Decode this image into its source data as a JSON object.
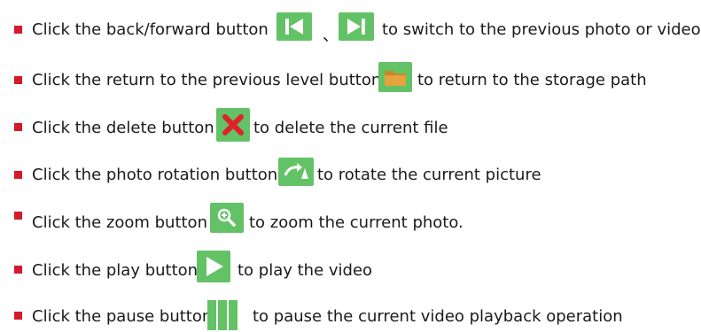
{
  "instructions": [
    {
      "pre": "Click the back/forward button",
      "separator": "、",
      "post": "to switch to the previous photo or video",
      "icons": [
        "skip-back-icon",
        "skip-forward-icon"
      ]
    },
    {
      "pre": "Click the return to the previous level button",
      "post": "to return to the storage path",
      "icons": [
        "folder-icon"
      ]
    },
    {
      "pre": "Click the delete button",
      "post": "to delete the current file",
      "icons": [
        "delete-x-icon"
      ]
    },
    {
      "pre": "Click the photo rotation button",
      "post": "to rotate the current picture",
      "icons": [
        "rotate-icon"
      ]
    },
    {
      "pre": "Click the zoom button",
      "post": "to zoom the current photo.",
      "icons": [
        "zoom-icon"
      ]
    },
    {
      "pre": "Click the play button",
      "post": "to play the video",
      "icons": [
        "play-icon"
      ]
    },
    {
      "pre": "Click the pause button",
      "post": "to pause the current video playback operation",
      "icons": [
        "pause-icon"
      ]
    }
  ],
  "colors": {
    "bullet": "#d4192a",
    "icon_bg": "#63c266",
    "icon_glyph": "#ffffff",
    "folder": "#e6a23c",
    "delete_x": "#e0202a",
    "text": "#1a1a1a"
  }
}
